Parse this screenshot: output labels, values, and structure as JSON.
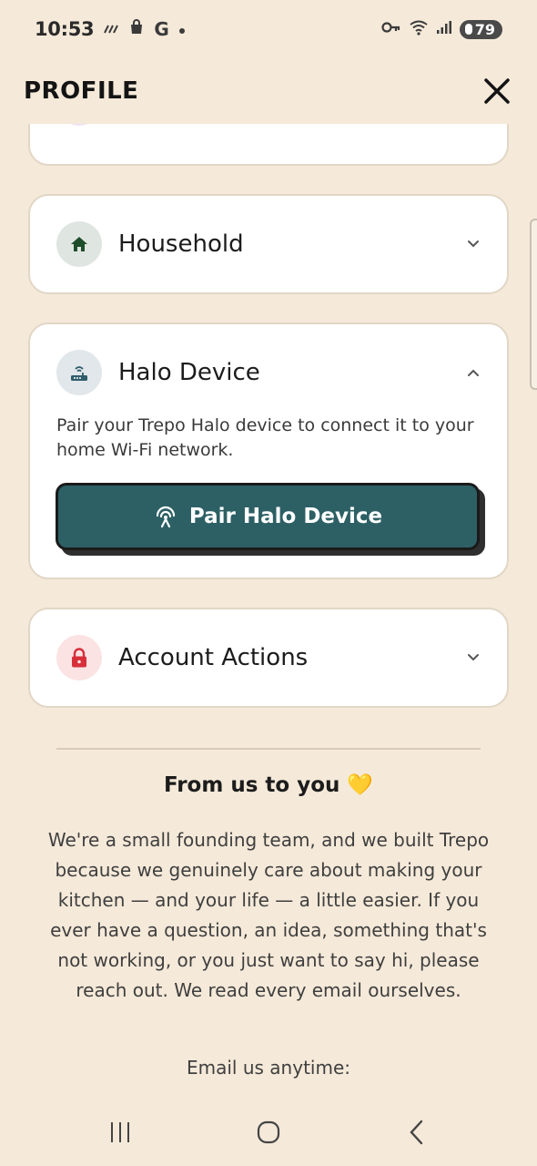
{
  "status_bar": {
    "time": "10:53",
    "left_icons": [
      "signal-strength-icon",
      "shopping-bag-icon",
      "google-icon",
      "dot-icon"
    ],
    "google_letter": "G",
    "battery": "79"
  },
  "header": {
    "title": "PROFILE",
    "close_icon": "close-icon"
  },
  "sections": {
    "household": {
      "label": "Household",
      "icon": "home-icon",
      "icon_bg": "#dfe5e1",
      "icon_color": "#1e4d2b",
      "expanded": false
    },
    "halo": {
      "label": "Halo Device",
      "icon": "router-icon",
      "icon_bg": "#e1e7ea",
      "icon_color": "#2f5d6b",
      "expanded": true,
      "description": "Pair your Trepo Halo device to connect it to your home Wi-Fi network.",
      "pair_button": "Pair Halo Device"
    },
    "account": {
      "label": "Account Actions",
      "icon": "lock-icon",
      "icon_bg": "#fbe3e3",
      "icon_color": "#d62f3a",
      "expanded": false
    }
  },
  "footer": {
    "heading": "From us to you 💛",
    "message": "We're a small founding team, and we built Trepo because we genuinely care about making your kitchen — and your life — a little easier. If you ever have a question, an idea, something that's not working, or you just want to say hi, please reach out. We read every email ourselves.",
    "email_label": "Email us anytime:"
  },
  "colors": {
    "background": "#f5e9d9",
    "accent": "#2d6065",
    "card_border": "#e2d6c6"
  },
  "nav_bar": {
    "items": [
      "recent-apps-icon",
      "home-button-icon",
      "back-icon"
    ]
  }
}
